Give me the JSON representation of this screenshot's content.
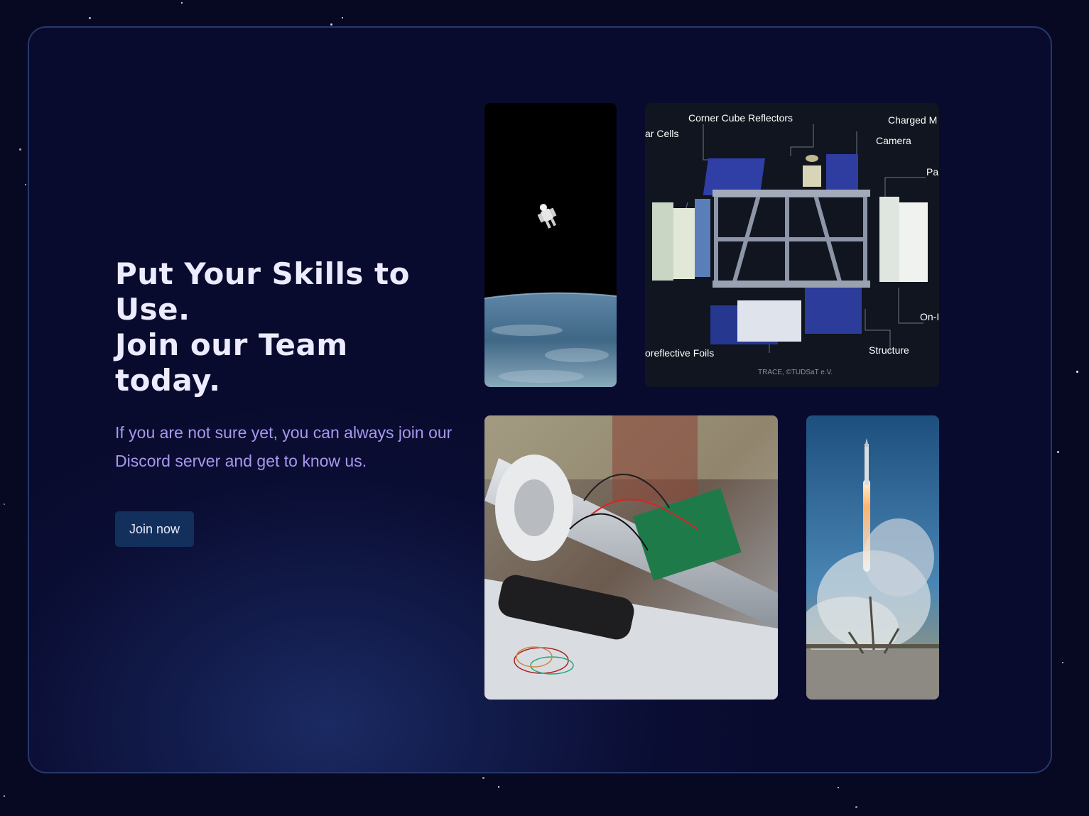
{
  "hero": {
    "headline_line1": "Put Your Skills to Use.",
    "headline_line2": "Join our Team today.",
    "subtitle": "If you are not sure yet, you can always join our Discord server and get to know us.",
    "cta_label": "Join now"
  },
  "gallery": {
    "diagram": {
      "label_corner_cube": "Corner Cube Reflectors",
      "label_charged": "Charged M",
      "label_solar": "ar Cells",
      "label_camera": "Camera",
      "label_pa": "Pa",
      "label_on": "On-I",
      "label_foils": "oreflective Foils",
      "label_structure": "Structure",
      "credit": "TRACE, ©TUDSaT e.V."
    }
  },
  "colors": {
    "background": "#070922",
    "card_border": "#26386d",
    "headline": "#ecebff",
    "subtitle": "#a997ee",
    "button": "#132f5c"
  }
}
